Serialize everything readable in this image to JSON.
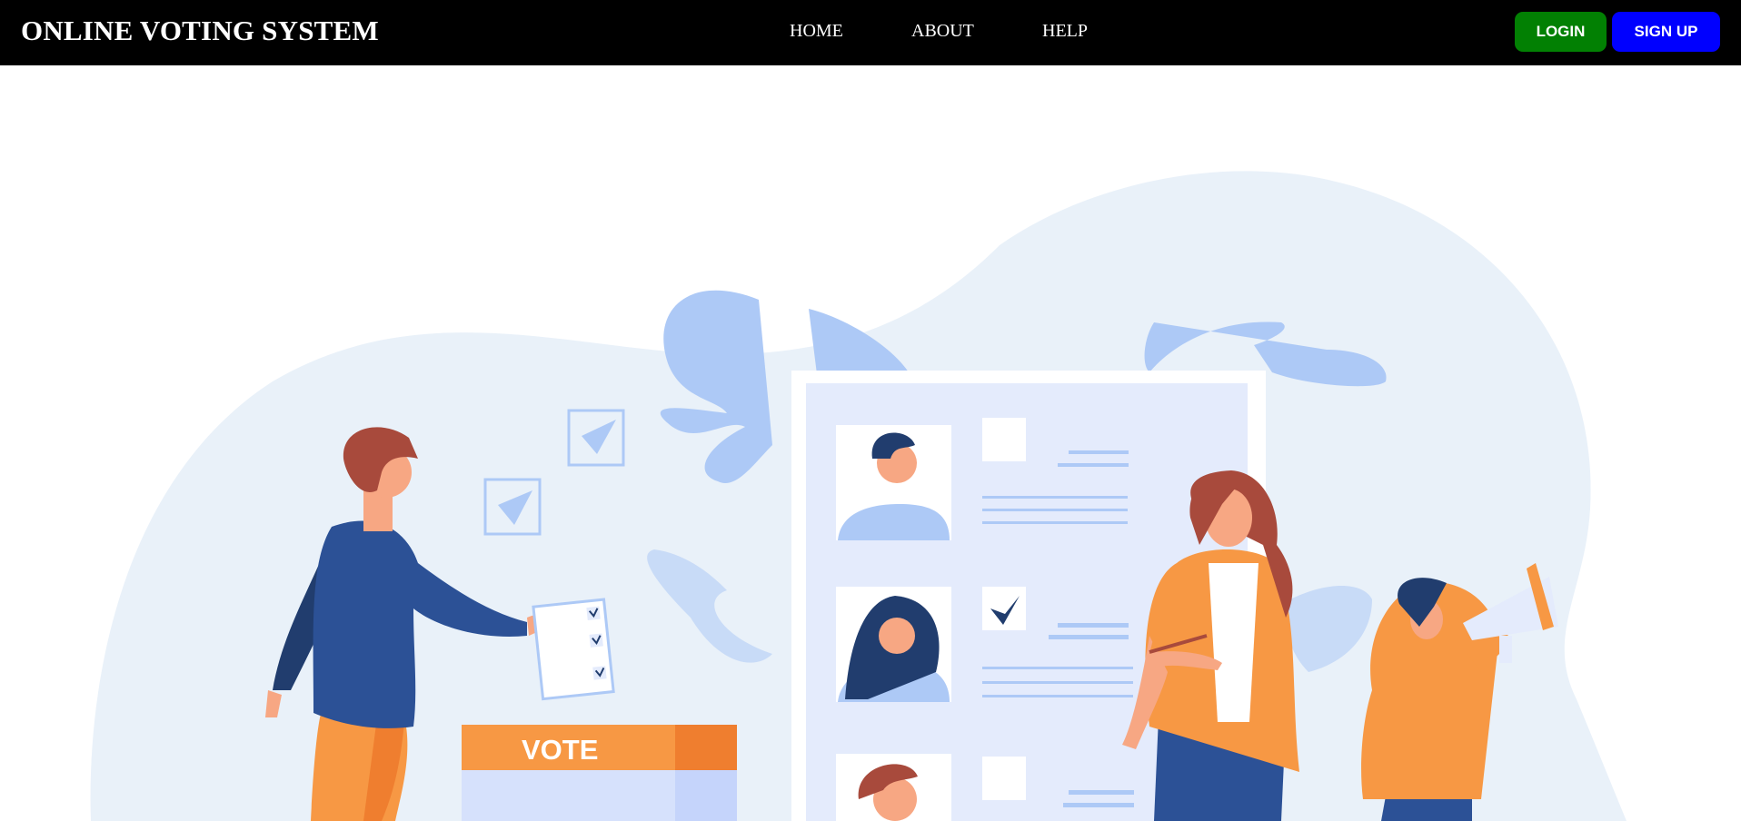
{
  "brand": {
    "title": "ONLINE VOTING SYSTEM"
  },
  "nav": {
    "items": [
      {
        "label": "HOME"
      },
      {
        "label": "ABOUT"
      },
      {
        "label": "HELP"
      }
    ]
  },
  "auth": {
    "login_label": "LOGIN",
    "signup_label": "SIGN UP"
  },
  "hero": {
    "ballot_box_label": "VOTE"
  },
  "colors": {
    "navbar_bg": "#000000",
    "login_bg": "#028003",
    "signup_bg": "#0000ff",
    "blob": "#e9f1f9",
    "leaf": "#adc9f6",
    "orange": "#f79844",
    "dark_blue": "#2c5196"
  }
}
